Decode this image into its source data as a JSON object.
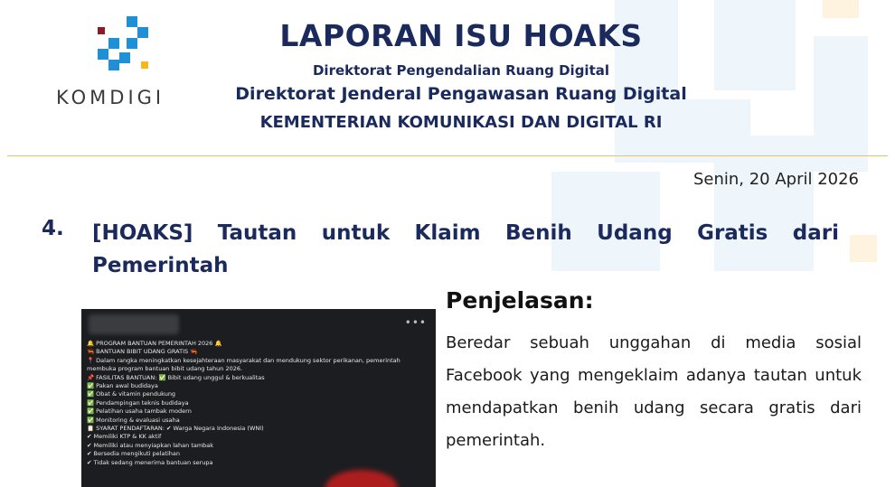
{
  "brand": {
    "logo_text": "KOMDIGI"
  },
  "header": {
    "title": "LAPORAN ISU HOAKS",
    "line1": "Direktorat Pengendalian Ruang Digital",
    "line2": "Direktorat  Jenderal Pengawasan Ruang Digital",
    "line3": "KEMENTERIAN KOMUNIKASI DAN DIGITAL RI"
  },
  "date": "Senin, 20 April 2026",
  "item": {
    "number": "4.",
    "title": "[HOAKS] Tautan untuk Klaim Benih Udang Gratis dari Pemerintah"
  },
  "explanation": {
    "heading": "Penjelasan:",
    "body": "Beredar sebuah unggahan di media sosial Facebook yang mengeklaim adanya tautan untuk mendapatkan benih udang secara gratis dari pemerintah."
  },
  "screenshot": {
    "more_icon": "more-horizontal-icon",
    "lines": [
      "🔔 PROGRAM BANTUAN PEMERINTAH 2026 🔔",
      "🦐 BANTUAN BIBIT UDANG GRATIS 🦐",
      "📍 Dalam rangka meningkatkan kesejahteraan masyarakat dan mendukung sektor perikanan, pemerintah",
      "membuka program bantuan bibit udang tahun 2026.",
      "📌 FASILITAS BANTUAN: ✅ Bibit udang unggul & berkualitas",
      "✅ Pakan awal budidaya",
      "✅ Obat & vitamin pendukung",
      "✅ Pendampingan teknis budidaya",
      "✅ Pelatihan usaha tambak modern",
      "✅ Monitoring & evaluasi usaha",
      "📋 SYARAT PENDAFTARAN: ✔ Warga Negara Indonesia (WNI)",
      "✔ Memiliki KTP & KK aktif",
      "✔ Memiliki atau menyiapkan lahan tambak",
      "✔ Bersedia mengikuti pelatihan",
      "✔ Tidak sedang menerima bantuan serupa"
    ]
  },
  "colors": {
    "navy": "#1b2a5c",
    "accent_blue": "#1f8fd6",
    "accent_yellow": "#f5b81c",
    "accent_red": "#8b1a2b",
    "rule": "#e0c36a"
  }
}
